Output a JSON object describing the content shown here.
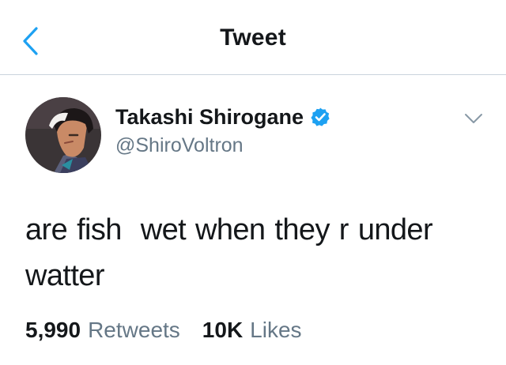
{
  "colors": {
    "accent": "#1da1f2",
    "text": "#14171a",
    "secondary_text": "#657786",
    "divider": "#c9d3dc"
  },
  "header": {
    "title": "Tweet",
    "back_icon": "chevron-left-icon"
  },
  "tweet": {
    "author": {
      "display_name": "Takashi Shirogane",
      "handle": "@ShiroVoltron",
      "verified": true,
      "avatar": "avatar-icon"
    },
    "more_icon": "chevron-down-icon",
    "text": "are fish  wet when they r under watter",
    "stats": {
      "retweets_count": "5,990",
      "retweets_label": "Retweets",
      "likes_count": "10K",
      "likes_label": "Likes"
    }
  }
}
